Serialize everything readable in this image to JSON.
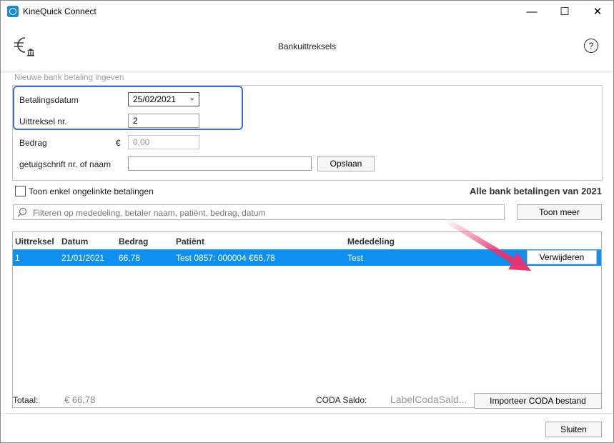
{
  "window": {
    "title": "KineQuick Connect",
    "controls": {
      "minimize": "—",
      "maximize": "☐",
      "close": "✕"
    }
  },
  "header": {
    "title": "Bankuittreksels",
    "help": "?"
  },
  "new_payment": {
    "group_title": "Nieuwe bank betaling ingeven",
    "date_label": "Betalingsdatum",
    "date_value": "25/02/2021",
    "statement_label": "Uittreksel nr.",
    "statement_value": "2",
    "amount_label": "Bedrag",
    "currency": "€",
    "amount_value": "0,00",
    "reference_label": "getuigschrift nr. of naam",
    "reference_value": "",
    "save_label": "Opslaan"
  },
  "filters": {
    "unlinked_label": "Toon enkel ongelinkte betalingen",
    "unlinked_checked": false,
    "summary_title": "Alle bank betalingen van 2021",
    "search_placeholder": "Filteren op mededeling, betaler naam, patiënt, bedrag, datum",
    "more_label": "Toon meer"
  },
  "table": {
    "columns": [
      "Uittreksel",
      "Datum",
      "Bedrag",
      "Patiënt",
      "Mededeling"
    ],
    "rows": [
      {
        "uittreksel": "1",
        "datum": "21/01/2021",
        "bedrag": "66,78",
        "patient": "Test 0857: 000004 €66,78",
        "mededeling": "Test",
        "action": "Verwijderen"
      }
    ]
  },
  "footer": {
    "total_label": "Totaal:",
    "total_value": "€ 66,78",
    "coda_label": "CODA Saldo:",
    "coda_value": "LabelCodaSald...",
    "import_label": "Importeer CODA bestand",
    "close_label": "Sluiten"
  },
  "colors": {
    "selection": "#0f8ff0",
    "highlight_border": "#3e6fc8",
    "arrow": "#e8336f"
  },
  "icons": {
    "app": "kinequick-app-icon",
    "header": "euro-bank-icon",
    "search": "search-icon",
    "dropdown": "chevron-down-icon"
  }
}
